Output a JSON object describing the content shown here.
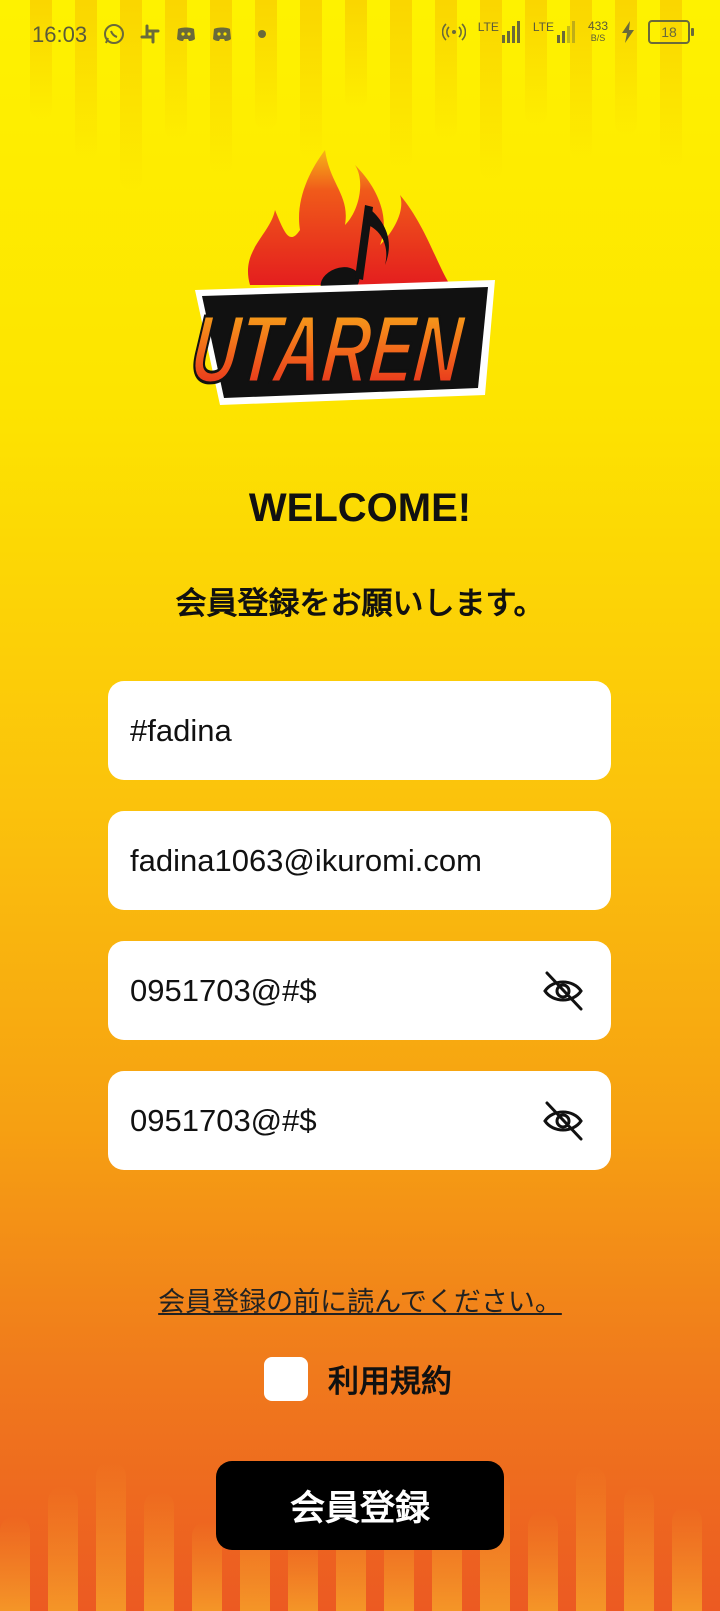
{
  "status_bar": {
    "time": "16:03",
    "left_icons": [
      "whatsapp-icon",
      "slack-icon",
      "discord-icon",
      "discord-icon",
      "dot"
    ],
    "network_1": "LTE",
    "network_2": "LTE",
    "speed_value": "433",
    "speed_unit": "B/S",
    "battery": "18"
  },
  "logo": {
    "text": "UTAREN"
  },
  "header": {
    "welcome": "WELCOME!",
    "subtitle": "会員登録をお願いします。"
  },
  "form": {
    "username_value": "#fadina",
    "email_value": "fadina1063@ikuromi.com",
    "password_value": "0951703@#$",
    "confirm_password_value": "0951703@#$"
  },
  "notice_link": "会員登録の前に読んでください。",
  "terms_label": "利用規約",
  "register_button": "会員登録",
  "colors": {
    "bg_top": "#fef200",
    "bg_bottom": "#ec5a22",
    "button_bg": "#000000",
    "button_text": "#ffffff"
  }
}
